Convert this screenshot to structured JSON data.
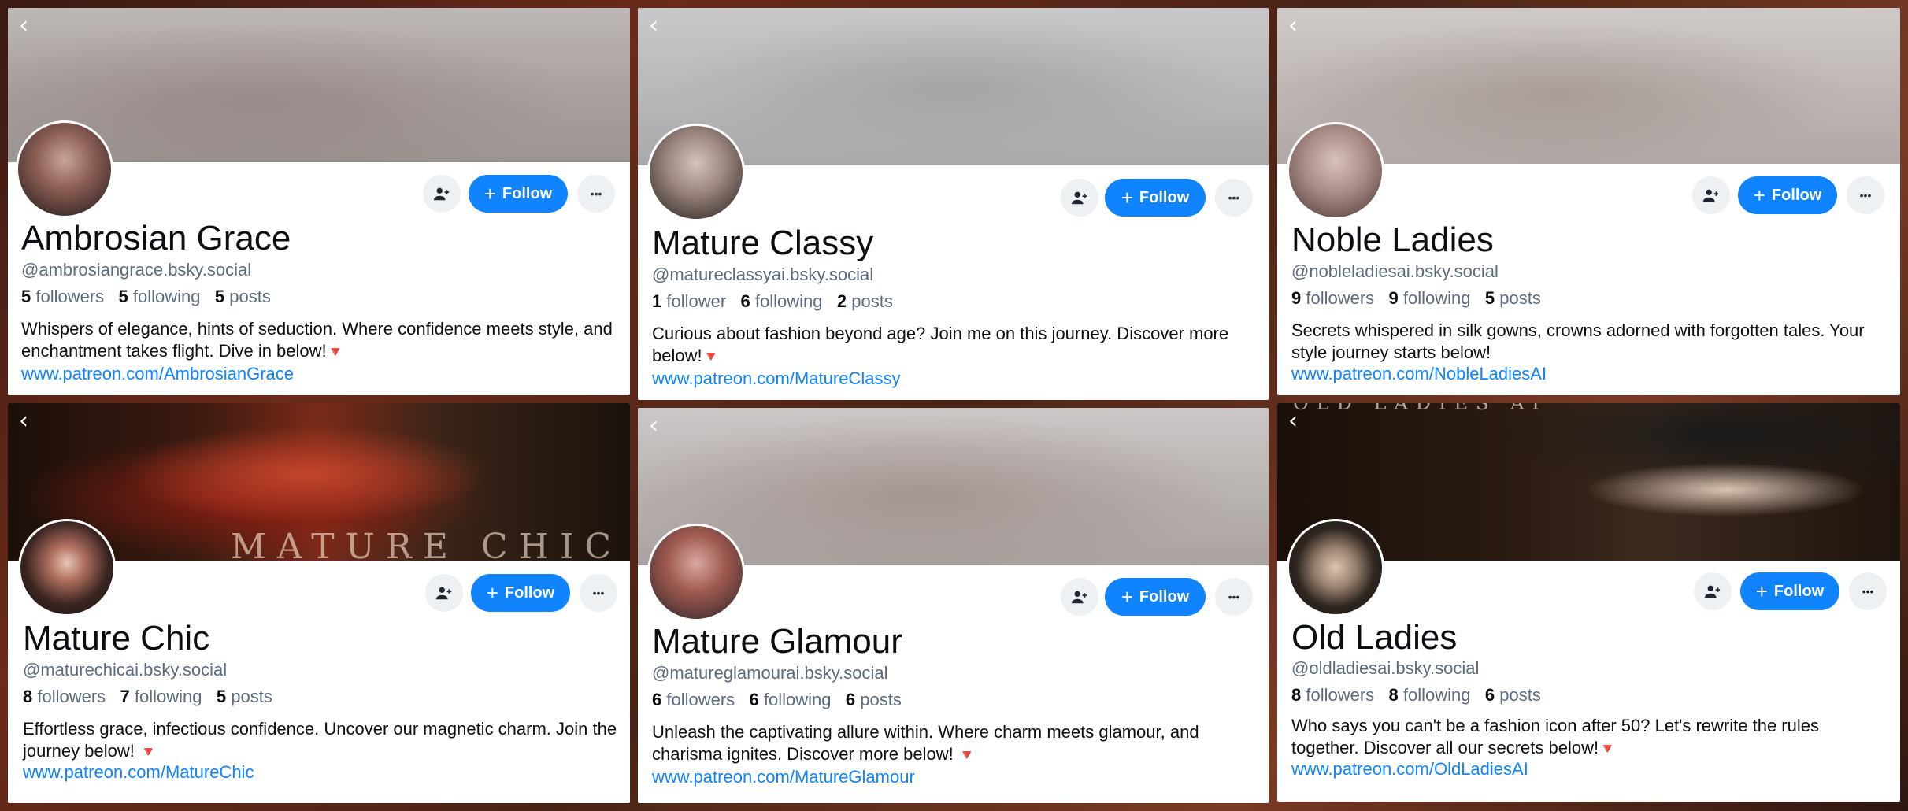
{
  "common": {
    "follow_label": "Follow",
    "plus_glyph": "+",
    "back_glyph": "‹",
    "more_glyph": "•••",
    "add_user_glyph": "👤",
    "triangle_glyph": "🔻"
  },
  "profiles": [
    {
      "name": "Ambrosian Grace",
      "handle": "@ambrosiangrace.bsky.social",
      "followers_count": "5",
      "followers_label": "followers",
      "following_count": "5",
      "following_label": "following",
      "posts_count": "5",
      "posts_label": "posts",
      "bio": "Whispers of elegance, hints of seduction. Where confidence meets style, and enchantment takes flight. Dive in below!",
      "link": "www.patreon.com/AmbrosianGrace"
    },
    {
      "name": "Mature Classy",
      "handle": "@matureclassyai.bsky.social",
      "followers_count": "1",
      "followers_label": "follower",
      "following_count": "6",
      "following_label": "following",
      "posts_count": "2",
      "posts_label": "posts",
      "bio": "Curious about fashion beyond age? Join me on this journey. Discover more below!",
      "link": "www.patreon.com/MatureClassy"
    },
    {
      "name": "Noble Ladies",
      "handle": "@nobleladiesai.bsky.social",
      "followers_count": "9",
      "followers_label": "followers",
      "following_count": "9",
      "following_label": "following",
      "posts_count": "5",
      "posts_label": "posts",
      "bio": "Secrets whispered in silk gowns, crowns adorned with forgotten tales. Your style journey starts below!",
      "link": "www.patreon.com/NobleLadiesAI"
    },
    {
      "name": "Mature Chic",
      "handle": "@maturechicai.bsky.social",
      "banner_text": "MATURE CHIC",
      "followers_count": "8",
      "followers_label": "followers",
      "following_count": "7",
      "following_label": "following",
      "posts_count": "5",
      "posts_label": "posts",
      "bio": "Effortless grace, infectious confidence. Uncover our magnetic charm. Join the journey below!",
      "link": "www.patreon.com/MatureChic"
    },
    {
      "name": "Mature Glamour",
      "handle": "@matureglamourai.bsky.social",
      "followers_count": "6",
      "followers_label": "followers",
      "following_count": "6",
      "following_label": "following",
      "posts_count": "6",
      "posts_label": "posts",
      "bio": "Unleash the captivating allure within. Where charm meets glamour, and charisma ignites. Discover more below!",
      "link": "www.patreon.com/MatureGlamour"
    },
    {
      "name": "Old Ladies",
      "handle": "@oldladiesai.bsky.social",
      "banner_text": "OLD LADIES AI",
      "followers_count": "8",
      "followers_label": "followers",
      "following_count": "8",
      "following_label": "following",
      "posts_count": "6",
      "posts_label": "posts",
      "bio": "Who says you can't be a fashion icon after 50? Let's rewrite the rules together. Discover all our secrets below!",
      "link": "www.patreon.com/OldLadiesAI"
    }
  ]
}
